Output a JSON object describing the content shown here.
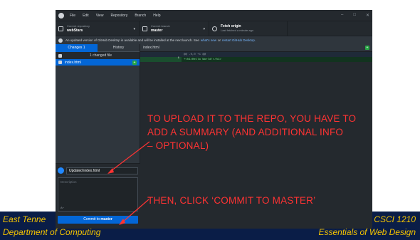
{
  "footer": {
    "left_line1": "East Tenne",
    "left_line2": "Department of Computing",
    "right_line1": "CSCI 1210",
    "right_line2": "Essentials of Web Design"
  },
  "app": {
    "menu": [
      "File",
      "Edit",
      "View",
      "Repository",
      "Branch",
      "Help"
    ],
    "toolbar": {
      "repo_label": "Current repository",
      "repo_value": "webStars",
      "branch_label": "Current branch",
      "branch_value": "master",
      "fetch_title": "Fetch origin",
      "fetch_sub": "Last fetched a minute ago"
    },
    "banner": {
      "text": "An updated version of GitHub Desktop is available and will be installed at the next launch. See",
      "link1": "what's new",
      "or": "or",
      "link2": "restart GitHub Desktop."
    },
    "tabs": {
      "changes": "Changes 1",
      "history": "History"
    },
    "changes_header": "1 changed file",
    "file_name": "index.html",
    "diff": {
      "file_name": "index.html",
      "hunk": "@@ -0,0 +1 @@",
      "line_number": "1",
      "line_code": "+<h1>Hello World!</h1>"
    },
    "commit": {
      "summary_value": "Updated index.html",
      "description_placeholder": "Description",
      "coauthor": "A+",
      "button_prefix": "Commit to",
      "button_branch": "master"
    }
  },
  "annotations": {
    "upload_line1": "TO UPLOAD IT TO THE REPO, YOU HAVE TO",
    "upload_line2": "ADD A SUMMARY (AND ADDITIONAL INFO",
    "upload_line3": "– OPTIONAL)",
    "commit_hint": "THEN, CLICK ‘COMMIT TO MASTER’"
  },
  "colors": {
    "footer_band": "#0a1d47",
    "footer_text": "#f5c400",
    "annotation": "#ff3333",
    "accent": "#0366d6",
    "added": "#28a745"
  }
}
